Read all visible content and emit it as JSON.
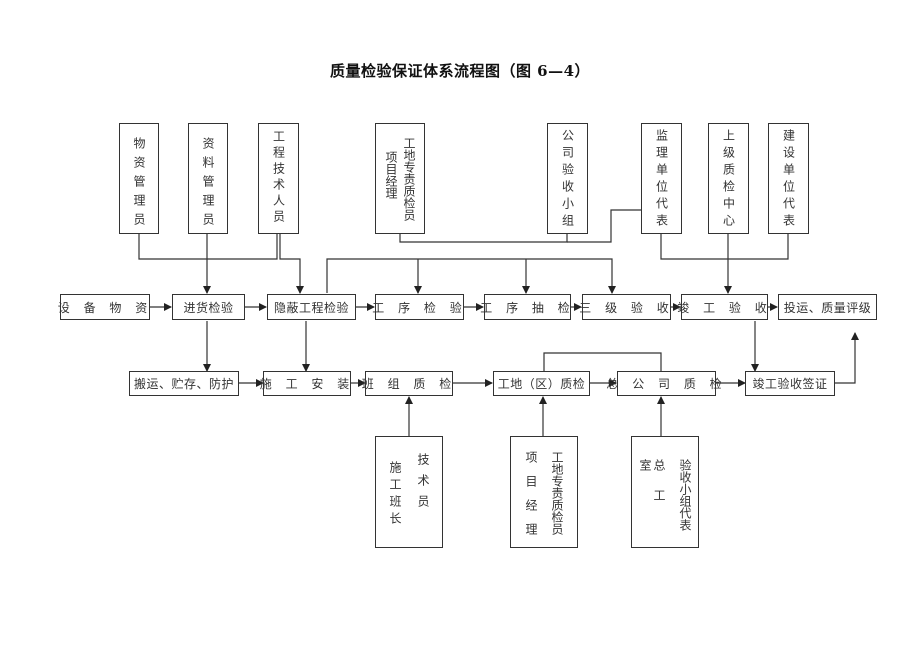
{
  "title": "质量检验保证体系流程图（图 6—4）",
  "top_roles": {
    "materials_manager": "物资管理员",
    "documents_manager": "资料管理员",
    "engineering_tech": "工程技术人员",
    "site_inspector_col1": "工地专责质检员",
    "site_inspector_col2": "项目经理",
    "company_acceptance": "公司验收小组",
    "supervisor_rep": "监理单位代表",
    "superior_qc_center": "上级质检中心",
    "owner_rep": "建设单位代表"
  },
  "main_flow": {
    "equipment_materials": "设 备 物 资",
    "incoming_inspection": "进货检验",
    "concealed_works": "隐蔽工程检验",
    "process_inspection": "工 序 检 验",
    "process_sampling": "工 序 抽 检",
    "three_level_acceptance": "三 级 验 收",
    "completion_acceptance": "竣 工 验 收",
    "operation_rating": "投运、质量评级"
  },
  "second_flow": {
    "handling_storage": "搬运、贮存、防护",
    "construction_install": "施 工 安 装",
    "team_qc": "班 组 质 检",
    "site_qc": "工地（区）质检",
    "company_qc": "总 公 司 质 检",
    "completion_certificate": "竣工验收签证"
  },
  "bottom_roles": {
    "team_leader": "施工班长",
    "technician": "技术员",
    "project_manager": "项目经理",
    "site_inspector": "工地专责质检员",
    "chief_engineer_office": "总工室",
    "acceptance_team_rep": "验收小组代表"
  },
  "colors": {
    "line": "#333333",
    "box_border": "#333333",
    "text": "#333333"
  }
}
